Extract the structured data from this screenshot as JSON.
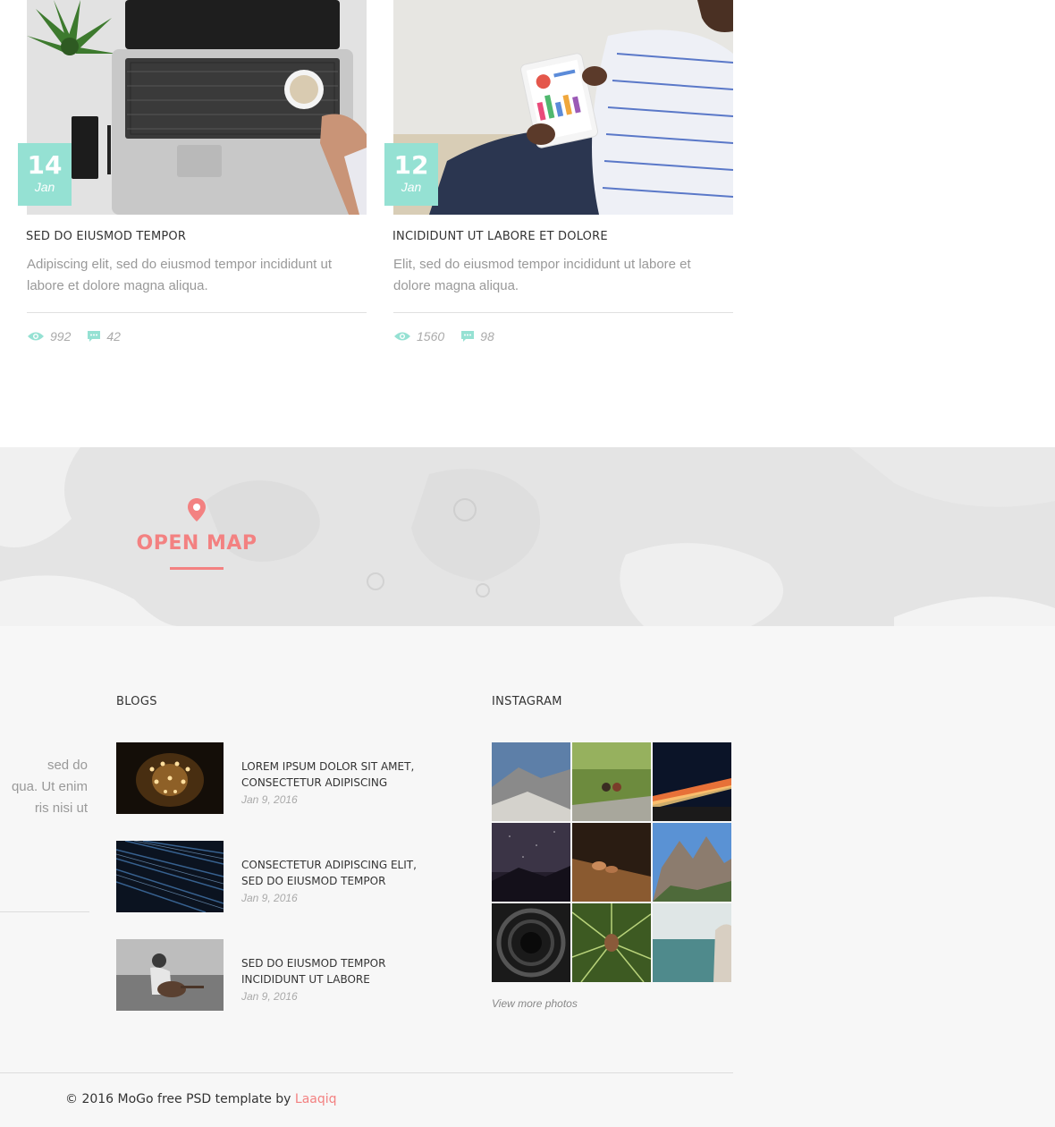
{
  "posts": [
    {
      "day": "14",
      "month": "Jan",
      "title": "SED DO EIUSMOD TEMPOR",
      "text": "Adipiscing elit, sed do eiusmod tempor incididunt ut labore et dolore magna aliqua.",
      "views": "992",
      "comments": "42",
      "image": "laptop-desk-photo"
    },
    {
      "day": "12",
      "month": "Jan",
      "title": "INCIDIDUNT UT LABORE ET DOLORE",
      "text": "Elit, sed do eiusmod tempor incididunt ut labore et dolore magna aliqua.",
      "views": "1560",
      "comments": "98",
      "image": "man-with-tablet-photo"
    }
  ],
  "map": {
    "label": "OPEN MAP",
    "icon": "map-pin-icon"
  },
  "footer": {
    "about_text": "sed do\nqua. Ut enim\nris nisi ut",
    "blogs": {
      "heading": "BLOGS",
      "items": [
        {
          "title": "LOREM IPSUM DOLOR SIT AMET, CONSECTETUR ADIPISCING",
          "date": "Jan 9, 2016",
          "image": "chandelier-photo"
        },
        {
          "title": "CONSECTETUR ADIPISCING ELIT, SED DO EIUSMOD TEMPOR",
          "date": "Jan 9, 2016",
          "image": "blue-streaks-photo"
        },
        {
          "title": "SED DO EIUSMOD TEMPOR INCIDIDUNT UT LABORE",
          "date": "Jan 9, 2016",
          "image": "guitar-player-photo"
        }
      ]
    },
    "instagram": {
      "heading": "INSTAGRAM",
      "photos": [
        "half-dome",
        "couple-on-cliff",
        "night-highway",
        "starry-sky",
        "wooden-table",
        "rocky-peaks",
        "tunnel",
        "pine-cone",
        "sea-woman"
      ],
      "view_more": "View more photos"
    },
    "copyright": "© 2016 MoGo free PSD template by ",
    "copyright_link": "Laaqiq"
  },
  "colors": {
    "accent_mint": "#95e1d3",
    "accent_coral": "#f38181"
  }
}
